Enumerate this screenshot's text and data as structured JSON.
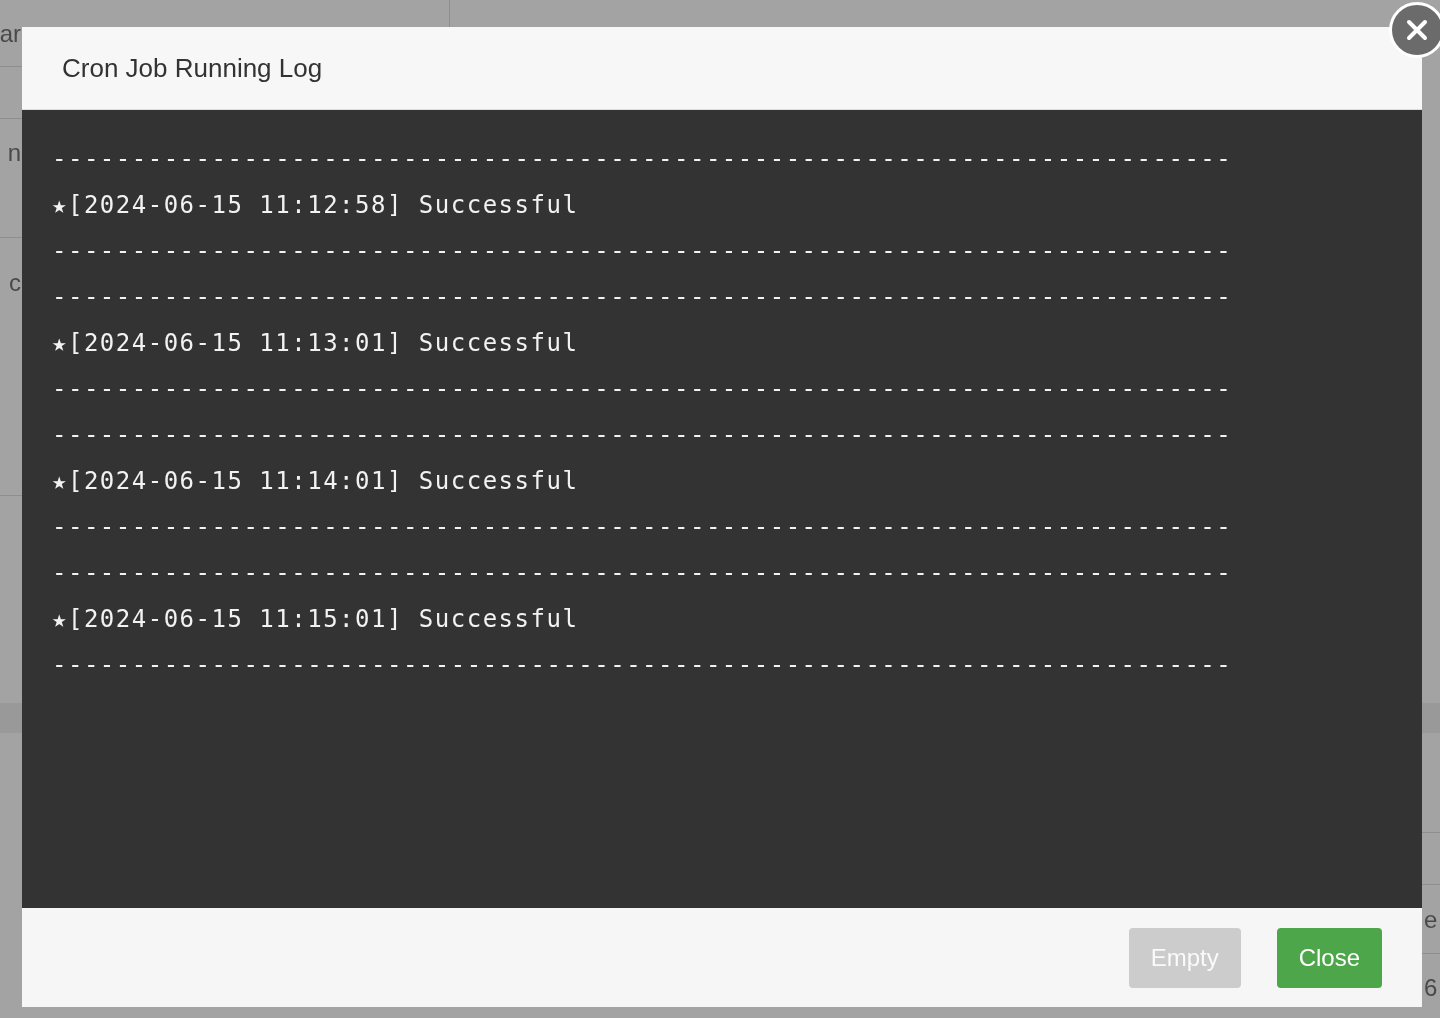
{
  "background": {
    "left_texts": [
      "ar",
      "n",
      "c"
    ],
    "right_texts": [
      "e",
      "6"
    ]
  },
  "modal": {
    "title": "Cron Job Running Log",
    "log_lines": [
      "--------------------------------------------------------------------------",
      "★[2024-06-15 11:12:58] Successful",
      "--------------------------------------------------------------------------",
      "--------------------------------------------------------------------------",
      "★[2024-06-15 11:13:01] Successful",
      "--------------------------------------------------------------------------",
      "--------------------------------------------------------------------------",
      "★[2024-06-15 11:14:01] Successful",
      "--------------------------------------------------------------------------",
      "--------------------------------------------------------------------------",
      "★[2024-06-15 11:15:01] Successful",
      "--------------------------------------------------------------------------"
    ],
    "buttons": [
      {
        "label": "Empty",
        "kind": "secondary",
        "disabled": true
      },
      {
        "label": "Close",
        "kind": "success",
        "disabled": false
      }
    ]
  }
}
